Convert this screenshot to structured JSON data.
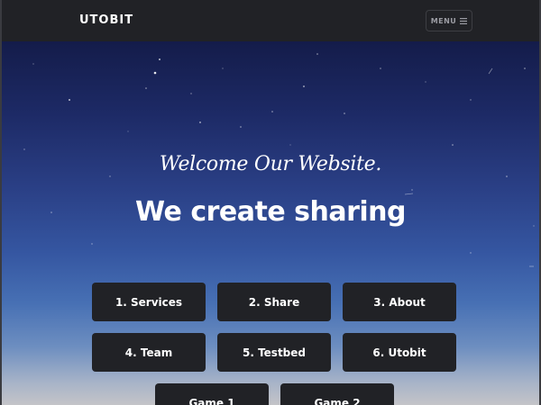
{
  "navbar": {
    "brand": "UTOBIT",
    "menu_label": "MENU",
    "menu_icon": "hamburger-icon"
  },
  "hero": {
    "subtitle": "Welcome Our Website.",
    "title": "We create sharing",
    "buttons": [
      {
        "label": "1. Services"
      },
      {
        "label": "2. Share"
      },
      {
        "label": "3. About"
      },
      {
        "label": "4. Team"
      },
      {
        "label": "5. Testbed"
      },
      {
        "label": "6. Utobit"
      },
      {
        "label": "Game 1"
      },
      {
        "label": "Game 2"
      }
    ]
  },
  "colors": {
    "navbar_bg": "#212226",
    "button_bg": "#212226",
    "sky_top": "#141c4a",
    "sky_mid": "#3556a1",
    "horizon": "#c4c4c8",
    "text": "#ffffff",
    "menu_text": "#9b9ca3"
  }
}
